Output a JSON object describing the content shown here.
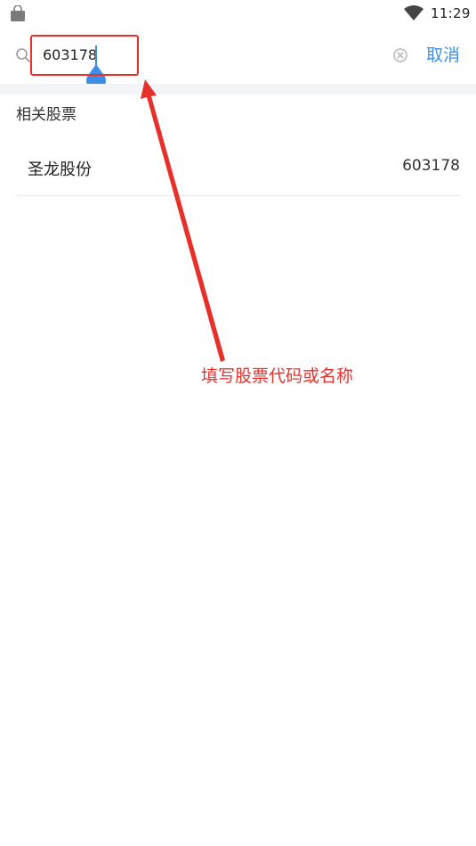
{
  "status_bar": {
    "time": "11:29",
    "left_icon": "shopping-bag-icon",
    "right_icon": "wifi-icon"
  },
  "search": {
    "value": "603178",
    "icon": "search-icon",
    "clear_icon": "clear-icon",
    "cancel_label": "取消"
  },
  "results": {
    "section_title": "相关股票",
    "items": [
      {
        "name": "圣龙股份",
        "code": "603178"
      }
    ]
  },
  "annotation": {
    "text": "填写股票代码或名称"
  },
  "colors": {
    "accent": "#3c8ee6",
    "annotation": "#e8302b",
    "divider": "#f2f4f7"
  }
}
